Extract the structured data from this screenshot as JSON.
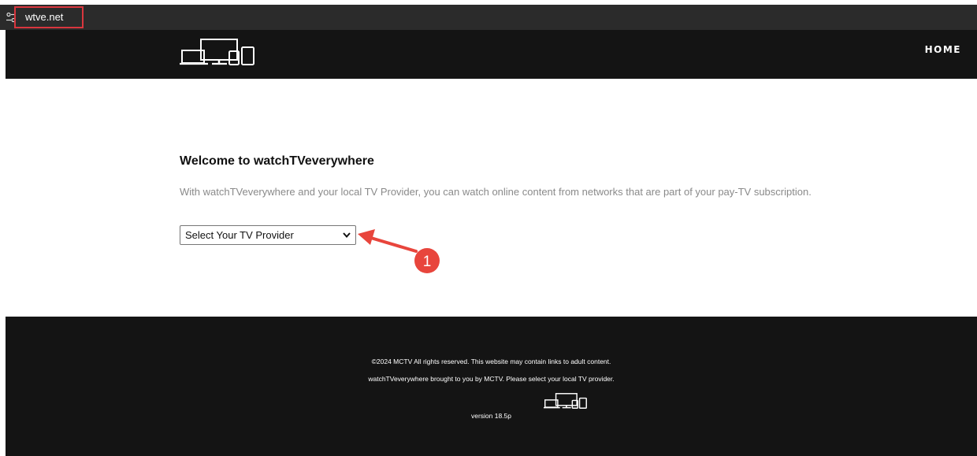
{
  "browser": {
    "url": "wtve.net",
    "site_icon": "site-info-icon",
    "highlight_color": "#d9363e"
  },
  "header": {
    "logo_icon": "devices-logo-icon",
    "nav_home": "HOME"
  },
  "main": {
    "title": "Welcome to watchTVeverywhere",
    "description": "With watchTVeverywhere and your local TV Provider, you can watch online content from networks that are part of your pay-TV subscription.",
    "provider_select": {
      "selected": "Select Your TV Provider"
    }
  },
  "annotation": {
    "number": "1",
    "color": "#e8453c"
  },
  "footer": {
    "copyright": "©2024 MCTV All rights reserved. This website may contain links to adult content.",
    "brought_by": "watchTVeverywhere brought to you by MCTV. Please select your local TV provider.",
    "version": "version 18.5p",
    "logo_icon": "devices-logo-icon"
  },
  "colors": {
    "header_bg": "#141414",
    "browser_bar_bg": "#2b2b2b",
    "description_text": "#8a8a8a"
  }
}
